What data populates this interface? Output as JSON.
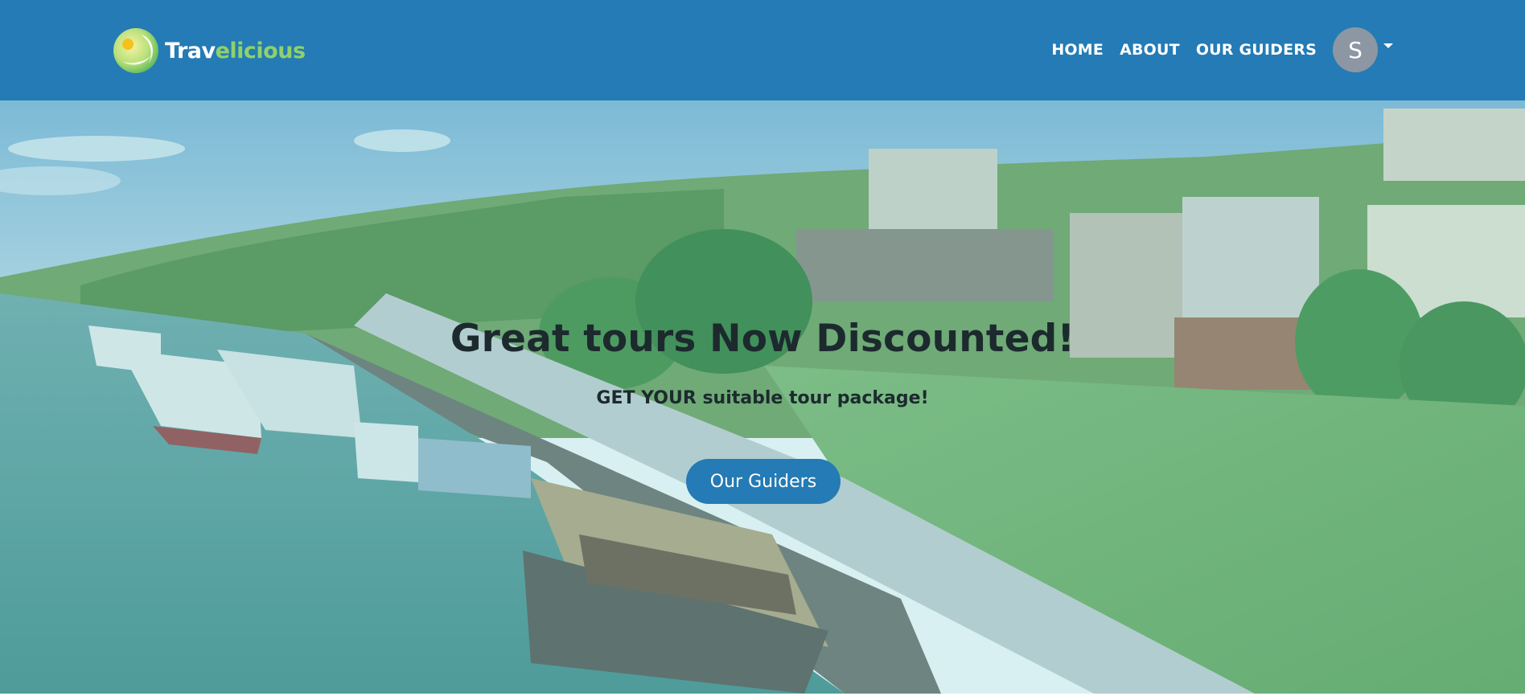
{
  "brand": {
    "name_part1": "Trav",
    "name_part2": "elicious",
    "logo_icon": "sun-leaf-logo-icon"
  },
  "nav": {
    "links": [
      {
        "label": "HOME"
      },
      {
        "label": "ABOUT"
      },
      {
        "label": "OUR GUIDERS"
      }
    ],
    "avatar_initial": "S",
    "avatar_menu_icon": "caret-down-icon"
  },
  "hero": {
    "title": "Great tours Now Discounted!",
    "subtitle": "GET YOUR suitable tour package!",
    "cta_label": "Our Guiders"
  },
  "colors": {
    "navbar": "#247bb5",
    "button": "#247bb5",
    "brand_accent": "#8fd16a",
    "avatar": "#8c97a3",
    "text_dark": "#1c2a2e"
  }
}
